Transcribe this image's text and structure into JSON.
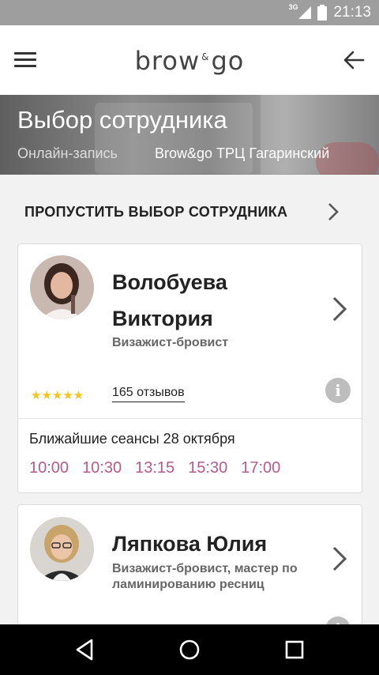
{
  "status_bar": {
    "network": "3G",
    "time": "21:13"
  },
  "header": {
    "logo_left": "brow",
    "logo_amp": "&",
    "logo_right": "go"
  },
  "hero": {
    "title": "Выбор сотрудника",
    "breadcrumb_1": "Онлайн-запись",
    "breadcrumb_2": "Brow&go ТРЦ Гагаринский"
  },
  "skip": {
    "label": "ПРОПУСТИТЬ ВЫБОР СОТРУДНИКА"
  },
  "employees": [
    {
      "name_line1": "Волобуева",
      "name_line2": "Виктория",
      "role": "Визажист-бровист",
      "rating": 5,
      "stars": "★★★★★",
      "reviews": "165 отзывов",
      "sessions_label": "Ближайшие сеансы 28 октября",
      "times": [
        "10:00",
        "10:30",
        "13:15",
        "15:30",
        "17:00"
      ]
    },
    {
      "name_line1": "Ляпкова Юлия",
      "role_line1": "Визажист-бровист, мастер по",
      "role_line2": "ламинированию ресниц"
    }
  ],
  "colors": {
    "accent_time": "#b85a8a",
    "star": "#f5c518"
  },
  "icons": [
    "menu-icon",
    "back-arrow-icon",
    "chevron-right-icon",
    "info-icon",
    "nav-back-icon",
    "nav-home-icon",
    "nav-recents-icon"
  ]
}
